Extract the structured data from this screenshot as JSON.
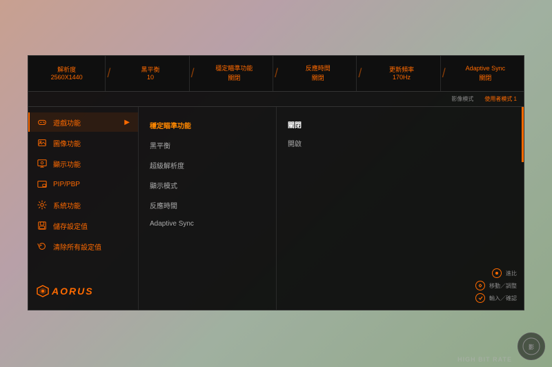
{
  "background": {
    "gradient": "linear-gradient(135deg, #c8a090 0%, #b8a0a8 30%, #a0b0a0 60%, #90a888 100%)"
  },
  "header": {
    "items": [
      {
        "label": "解析度",
        "value": "2560X1440",
        "sub": ""
      },
      {
        "label": "黑平衡",
        "value": "10",
        "sub": ""
      },
      {
        "label": "穩定瞄準功能",
        "value": "關閉",
        "sub": ""
      },
      {
        "label": "反應時間",
        "value": "關閉",
        "sub": ""
      },
      {
        "label": "更新頻率",
        "value": "170Hz",
        "sub": ""
      },
      {
        "label": "Adaptive Sync",
        "value": "關閉",
        "sub": ""
      }
    ]
  },
  "sub_header": {
    "items": [
      {
        "label": "影像模式",
        "active": false
      },
      {
        "label": "使用者模式 1",
        "active": true
      }
    ]
  },
  "sidebar": {
    "items": [
      {
        "id": "gaming",
        "label": "遊戲功能",
        "icon": "gamepad",
        "active": true
      },
      {
        "id": "image",
        "label": "圖像功能",
        "icon": "image",
        "active": false
      },
      {
        "id": "display",
        "label": "顯示功能",
        "icon": "display",
        "active": false
      },
      {
        "id": "pip",
        "label": "PIP/PBP",
        "icon": "pip",
        "active": false
      },
      {
        "id": "system",
        "label": "系統功能",
        "icon": "gear",
        "active": false
      },
      {
        "id": "save",
        "label": "儲存設定值",
        "icon": "save",
        "active": false
      },
      {
        "id": "reset",
        "label": "清除所有設定值",
        "icon": "reset",
        "active": false
      }
    ],
    "logo": "AORUS"
  },
  "menu": {
    "title": "穩定瞄準功能",
    "items": [
      {
        "label": "穩定瞄準功能",
        "active": true
      },
      {
        "label": "黑平衡",
        "active": false
      },
      {
        "label": "超級解析度",
        "active": false
      },
      {
        "label": "顯示模式",
        "active": false
      },
      {
        "label": "反應時間",
        "active": false
      },
      {
        "label": "Adaptive Sync",
        "active": false
      }
    ]
  },
  "right_panel": {
    "items": [
      {
        "label": "關閉",
        "highlighted": true
      },
      {
        "label": "開啟",
        "highlighted": false
      }
    ]
  },
  "nav_hints": [
    {
      "label": "進比",
      "icon": "circle-dot"
    },
    {
      "label": "移動／調整",
      "icon": "circle-arrows"
    },
    {
      "label": "輸入／確認",
      "icon": "circle-enter"
    }
  ],
  "watermark": {
    "text": "HIGH BIT RATE"
  }
}
